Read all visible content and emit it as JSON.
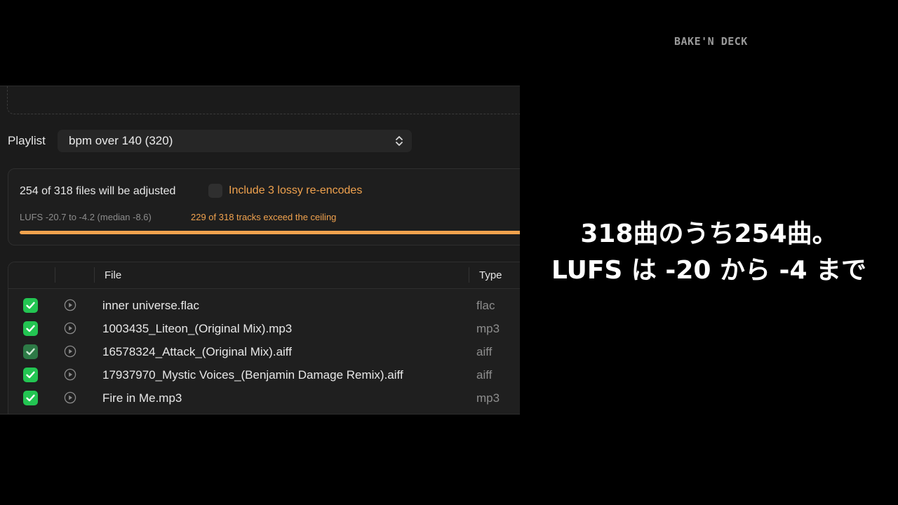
{
  "brand": "BAKE'N DECK",
  "playlist": {
    "label": "Playlist",
    "selected": "bpm over 140 (320)"
  },
  "summary": {
    "adjust_text": "254 of 318 files will be adjusted",
    "lossy_label": "Include 3 lossy re-encodes",
    "lufs_text": "LUFS -20.7 to -4.2 (median -8.6)",
    "exceed_text": "229 of 318 tracks exceed the ceiling",
    "progress_fraction": 1.0,
    "accent_color": "#f0a24e"
  },
  "table": {
    "headers": {
      "file": "File",
      "type": "Type"
    },
    "rows": [
      {
        "file": "inner universe.flac",
        "type": "flac",
        "checked": true
      },
      {
        "file": "1003435_Liteon_(Original Mix).mp3",
        "type": "mp3",
        "checked": true
      },
      {
        "file": "16578324_Attack_(Original Mix).aiff",
        "type": "aiff",
        "checked": true
      },
      {
        "file": "17937970_Mystic Voices_(Benjamin Damage Remix).aiff",
        "type": "aiff",
        "checked": true
      },
      {
        "file": "Fire in Me.mp3",
        "type": "mp3",
        "checked": true
      }
    ]
  },
  "caption": {
    "line1": "318曲のうち254曲。",
    "line2": "LUFS は -20 から -4 まで"
  },
  "colors": {
    "check": "#23c552",
    "panel": "#1b1b1b"
  },
  "icons": {
    "select": "chevron-up-down-icon",
    "play": "play-circle-icon",
    "check": "checkmark-icon"
  }
}
